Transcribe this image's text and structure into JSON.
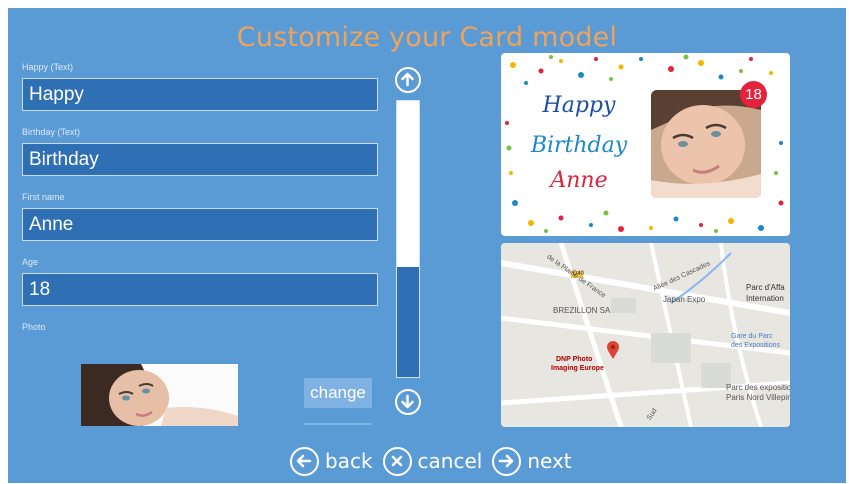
{
  "page": {
    "title": "Customize your Card model"
  },
  "form": {
    "happy": {
      "label": "Happy (Text)",
      "value": "Happy"
    },
    "birthday": {
      "label": "Birthday (Text)",
      "value": "Birthday"
    },
    "first_name": {
      "label": "First name",
      "value": "Anne"
    },
    "age": {
      "label": "Age",
      "value": "18"
    },
    "photo": {
      "label": "Photo",
      "change_label": "change"
    }
  },
  "scrollbar": {
    "position_fraction": 0.6
  },
  "card": {
    "line1": "Happy",
    "line2": "Birthday",
    "line3": "Anne",
    "badge": "18",
    "colors": {
      "line1": "#1e4fa3",
      "line2": "#1e88c7",
      "line3": "#d7263d"
    }
  },
  "map": {
    "poi_main": "DNP Photo",
    "poi_main2": "Imaging Europe",
    "brezillon": "BREZILLON SA",
    "japan": "Japan Expo",
    "parc1": "Parc d'Affa",
    "parc1b": "Internation",
    "gare1": "Gare du Parc",
    "gare2": "des Expositions",
    "parc2": "Parc des expositio",
    "parc2b": "Paris Nord Villepin",
    "allee": "Allée des Cascades",
    "plaine": "de la Plaine de France",
    "road": "D40",
    "sud": "Sud"
  },
  "nav": {
    "back": "back",
    "cancel": "cancel",
    "next": "next"
  },
  "icons": {
    "scroll_up": "arrow-up-icon",
    "scroll_down": "arrow-down-icon",
    "back": "arrow-left-icon",
    "cancel": "close-icon",
    "next": "arrow-right-icon"
  }
}
